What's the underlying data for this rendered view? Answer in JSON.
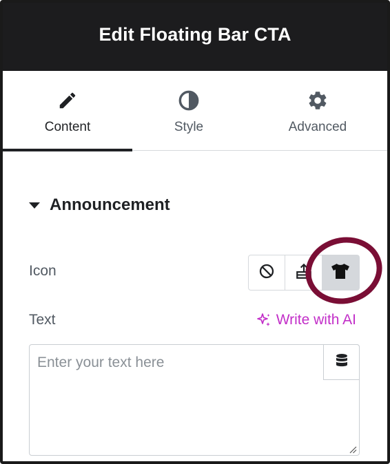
{
  "header": {
    "title": "Edit Floating Bar CTA"
  },
  "tabs": [
    {
      "label": "Content",
      "icon": "pencil-icon",
      "active": true
    },
    {
      "label": "Style",
      "icon": "half-circle-icon",
      "active": false
    },
    {
      "label": "Advanced",
      "icon": "gear-icon",
      "active": false
    }
  ],
  "section": {
    "title": "Announcement",
    "expanded": true
  },
  "icon_field": {
    "label": "Icon",
    "options": [
      "none-icon",
      "upload-icon",
      "tshirt-icon"
    ],
    "selected": "tshirt-icon"
  },
  "text_field": {
    "label": "Text",
    "ai_link": "Write with AI",
    "placeholder": "Enter your text here",
    "value": ""
  },
  "colors": {
    "header_bg": "#1c1c1e",
    "accent_ai": "#c22ec8",
    "highlight_ring": "#7a0e35",
    "selected_bg": "#d5d8dc"
  }
}
